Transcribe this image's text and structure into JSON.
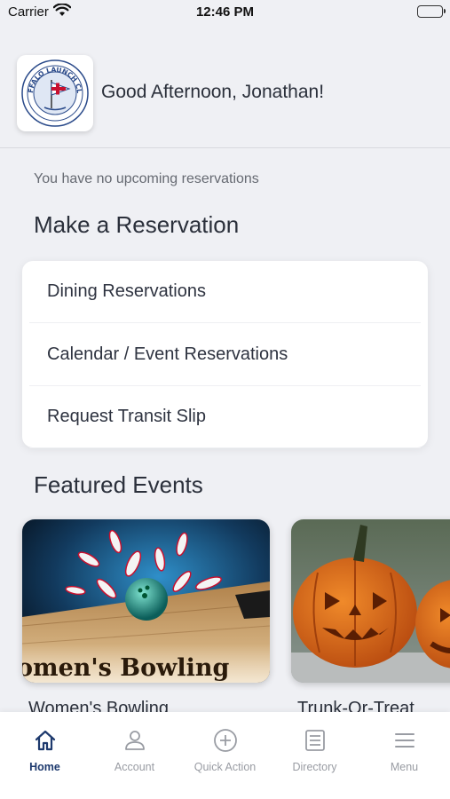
{
  "status_bar": {
    "carrier": "Carrier",
    "time": "12:46 PM"
  },
  "header": {
    "greeting": "Good Afternoon, Jonathan!",
    "logo_text": "BUFFALO LAUNCH CLUB"
  },
  "reservations": {
    "empty_message": "You have no upcoming reservations"
  },
  "make_reservation": {
    "title": "Make a Reservation",
    "items": [
      {
        "label": "Dining Reservations"
      },
      {
        "label": "Calendar / Event Reservations"
      },
      {
        "label": "Request Transit Slip"
      }
    ]
  },
  "featured_events": {
    "title": "Featured Events",
    "events": [
      {
        "name": "Women's Bowling",
        "banner": "omen's Bowling"
      },
      {
        "name": "Trunk-Or-Treat"
      }
    ]
  },
  "tab_bar": {
    "active": "Home",
    "tabs": [
      {
        "label": "Home",
        "icon": "home-icon"
      },
      {
        "label": "Account",
        "icon": "account-icon"
      },
      {
        "label": "Quick Action",
        "icon": "plus-circle-icon"
      },
      {
        "label": "Directory",
        "icon": "directory-icon"
      },
      {
        "label": "Menu",
        "icon": "menu-icon"
      }
    ]
  },
  "colors": {
    "accent": "#1e3a6e",
    "background": "#eff0f4",
    "inactive": "#999ca3"
  }
}
